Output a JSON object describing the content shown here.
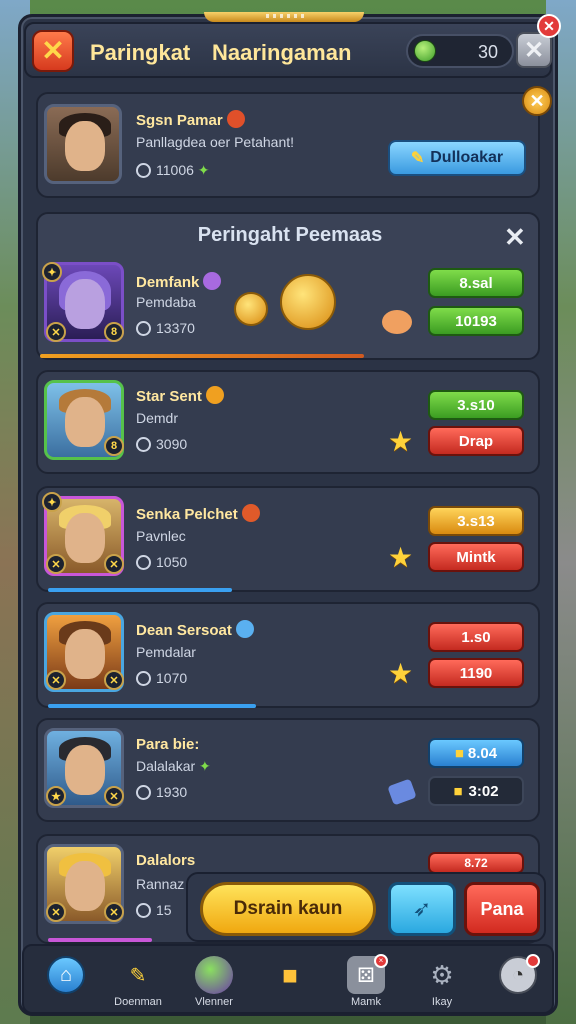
{
  "header": {
    "title_left": "Paringkat",
    "title_right": "Naaringaman",
    "gem_count": "30"
  },
  "my_card": {
    "name": "Sgsn Pamar",
    "subtitle": "Panllagdea oer Petahant!",
    "score": "11006",
    "button_label": "Dulloakar"
  },
  "popup": {
    "title": "Peringaht Peemaas",
    "player": {
      "name": "Demfank",
      "subtitle": "Pemdaba",
      "score": "13370",
      "top_pill": "8.sal",
      "bottom_pill": "10193"
    }
  },
  "rows": [
    {
      "name": "Star Sent",
      "subtitle": "Demdr",
      "score": "3090",
      "top_pill": "3.s10",
      "bottom_pill": "Drap"
    },
    {
      "name": "Senka Pelchet",
      "subtitle": "Pavnlec",
      "score": "1050",
      "top_pill": "3.s13",
      "bottom_pill": "Mintk"
    },
    {
      "name": "Dean Sersoat",
      "subtitle": "Pemdalar",
      "score": "1070",
      "top_pill": "1.s0",
      "bottom_pill": "1190"
    },
    {
      "name": "Para bie:",
      "subtitle": "Dalalakar",
      "score": "1930",
      "top_pill": "8.04",
      "bottom_pill": "3:02"
    },
    {
      "name": "Dalalors",
      "subtitle": "Rannaz",
      "score": "15",
      "top_pill": "8.72"
    }
  ],
  "actions": {
    "primary_label": "Dsrain kaun",
    "secondary_label": "Pana"
  },
  "nav": [
    {
      "label": ""
    },
    {
      "label": "Doenman"
    },
    {
      "label": "Vlenner"
    },
    {
      "label": ""
    },
    {
      "label": "Mamk"
    },
    {
      "label": "Ikay"
    },
    {
      "label": ""
    }
  ]
}
